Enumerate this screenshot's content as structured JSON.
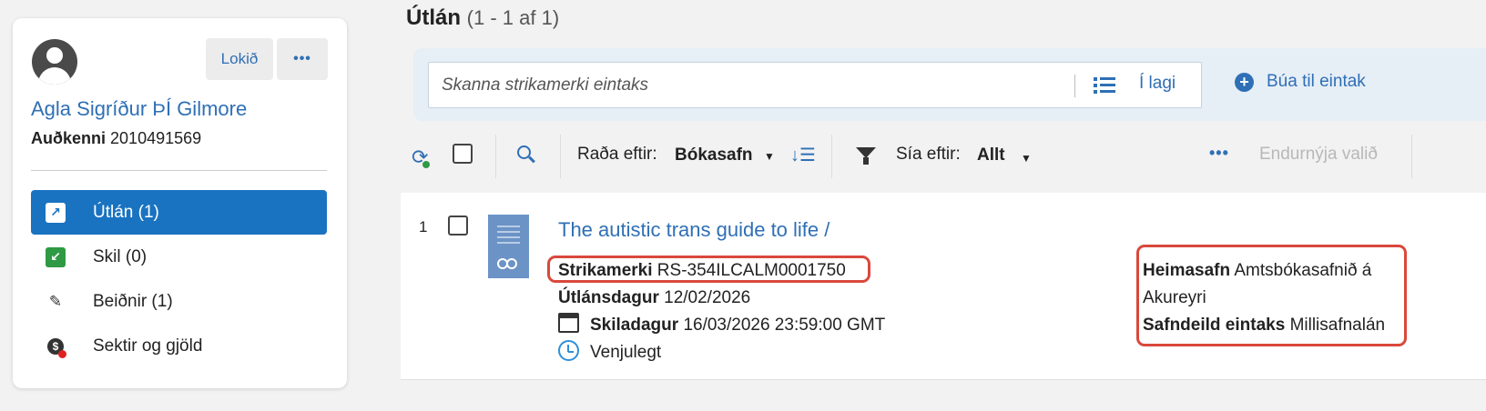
{
  "user": {
    "name": "Agla Sigríður ÞÍ Gilmore",
    "id_label": "Auðkenni",
    "id_value": "2010491569",
    "done_label": "Lokið",
    "more_label": "•••"
  },
  "nav": [
    {
      "label": "Útlán (1)",
      "icon": "loan-icon",
      "active": true
    },
    {
      "label": "Skil (0)",
      "icon": "return-icon",
      "active": false
    },
    {
      "label": "Beiðnir (1)",
      "icon": "request-icon",
      "active": false
    },
    {
      "label": "Sektir og gjöld",
      "icon": "fine-icon",
      "active": false
    }
  ],
  "main": {
    "title": "Útlán",
    "count": "(1 - 1 af 1)",
    "scan_placeholder": "Skanna strikamerki eintaks",
    "ok_label": "Í lagi",
    "create_label": "Búa til eintak",
    "sort_label": "Raða eftir:",
    "sort_value": "Bókasafn",
    "filter_label": "Sía eftir:",
    "filter_value": "Allt",
    "more_label": "•••",
    "renew_label": "Endurnýja valið"
  },
  "loan": {
    "index": "1",
    "title": "The autistic trans guide to life /",
    "barcode_label": "Strikamerki",
    "barcode_value": "RS-354ILCALM0001750",
    "loan_date_label": "Útlánsdagur",
    "loan_date_value": "12/02/2026",
    "due_label": "Skiladagur",
    "due_value": "16/03/2026 23:59:00 GMT",
    "policy": "Venjulegt",
    "home_library_label": "Heimasafn",
    "home_library_value_1": "Amtsbókasafnið á",
    "home_library_value_2": "Akureyri",
    "item_location_label": "Safndeild eintaks",
    "item_location_value": "Millisafnalán"
  },
  "colors": {
    "accent": "#1a73c0",
    "link": "#2f6fb5",
    "highlight": "#d9483b",
    "green": "#2e9a44"
  }
}
